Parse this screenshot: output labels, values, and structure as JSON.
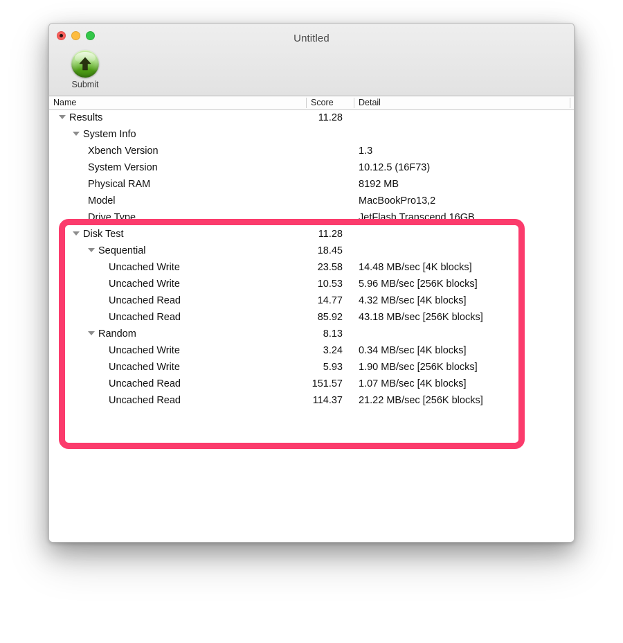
{
  "window": {
    "title": "Untitled",
    "traffic_lights": [
      "close",
      "minimize",
      "zoom"
    ]
  },
  "toolbar": {
    "submit_label": "Submit",
    "submit_icon": "upload-arrow-icon"
  },
  "table": {
    "columns": [
      "Name",
      "Score",
      "Detail"
    ],
    "rows": [
      {
        "indent": 0,
        "expandable": true,
        "name": "Results",
        "score": "11.28",
        "detail": ""
      },
      {
        "indent": 1,
        "expandable": true,
        "name": "System Info",
        "score": "",
        "detail": ""
      },
      {
        "indent": 2,
        "expandable": false,
        "name": "Xbench Version",
        "score": "",
        "detail": "1.3"
      },
      {
        "indent": 2,
        "expandable": false,
        "name": "System Version",
        "score": "",
        "detail": "10.12.5 (16F73)"
      },
      {
        "indent": 2,
        "expandable": false,
        "name": "Physical RAM",
        "score": "",
        "detail": "8192 MB"
      },
      {
        "indent": 2,
        "expandable": false,
        "name": "Model",
        "score": "",
        "detail": "MacBookPro13,2"
      },
      {
        "indent": 2,
        "expandable": false,
        "name": "Drive Type",
        "score": "",
        "detail": "JetFlash Transcend 16GB"
      },
      {
        "indent": 1,
        "expandable": true,
        "name": "Disk Test",
        "score": "11.28",
        "detail": ""
      },
      {
        "indent": 2,
        "expandable": true,
        "name": "Sequential",
        "score": "18.45",
        "detail": ""
      },
      {
        "indent": 3,
        "expandable": false,
        "name": "Uncached Write",
        "score": "23.58",
        "detail": "14.48 MB/sec [4K blocks]"
      },
      {
        "indent": 3,
        "expandable": false,
        "name": "Uncached Write",
        "score": "10.53",
        "detail": "5.96 MB/sec [256K blocks]"
      },
      {
        "indent": 3,
        "expandable": false,
        "name": "Uncached Read",
        "score": "14.77",
        "detail": "4.32 MB/sec [4K blocks]"
      },
      {
        "indent": 3,
        "expandable": false,
        "name": "Uncached Read",
        "score": "85.92",
        "detail": "43.18 MB/sec [256K blocks]"
      },
      {
        "indent": 2,
        "expandable": true,
        "name": "Random",
        "score": "8.13",
        "detail": ""
      },
      {
        "indent": 3,
        "expandable": false,
        "name": "Uncached Write",
        "score": "3.24",
        "detail": "0.34 MB/sec [4K blocks]"
      },
      {
        "indent": 3,
        "expandable": false,
        "name": "Uncached Write",
        "score": "5.93",
        "detail": "1.90 MB/sec [256K blocks]"
      },
      {
        "indent": 3,
        "expandable": false,
        "name": "Uncached Read",
        "score": "151.57",
        "detail": "1.07 MB/sec [4K blocks]"
      },
      {
        "indent": 3,
        "expandable": false,
        "name": "Uncached Read",
        "score": "114.37",
        "detail": "21.22 MB/sec [256K blocks]"
      }
    ]
  },
  "annotation": {
    "highlight_color": "#fb3b6c",
    "shape": "rounded-rectangle-outline"
  }
}
